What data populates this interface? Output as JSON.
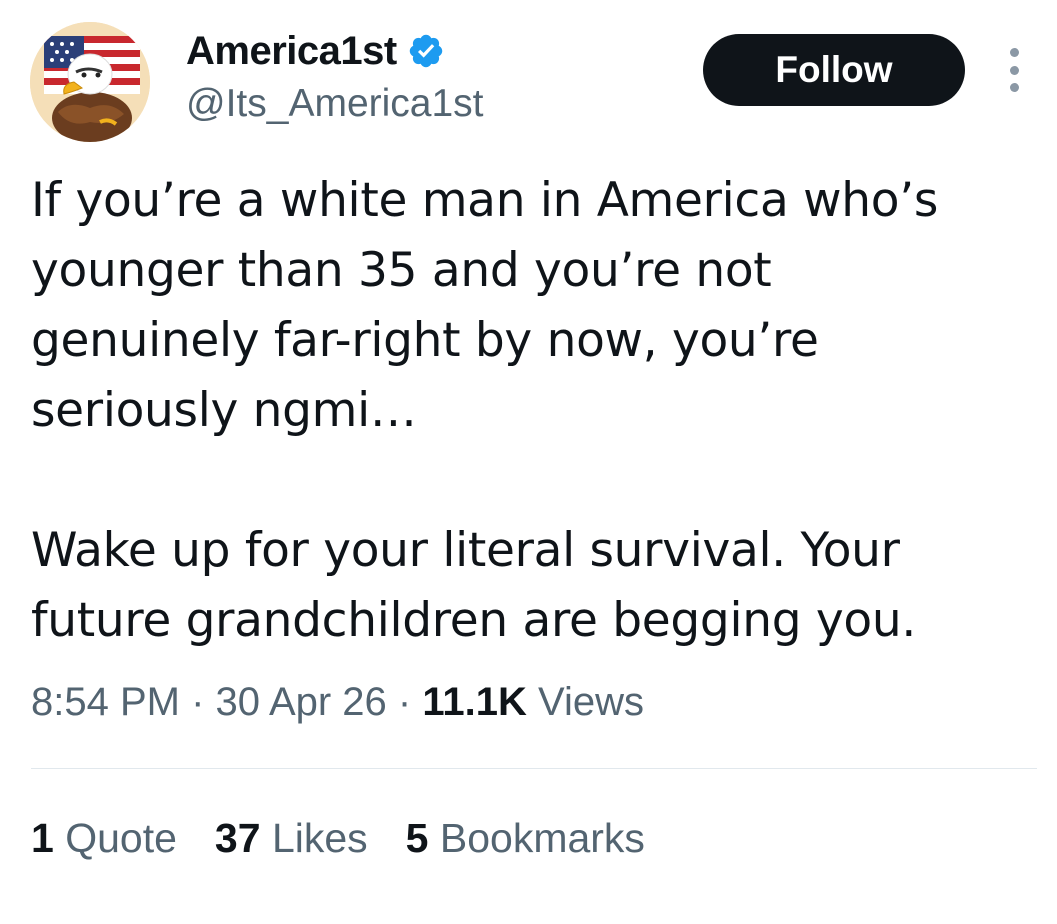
{
  "author": {
    "display_name": "America1st",
    "handle": "@Its_America1st",
    "verified": true
  },
  "follow_button": {
    "label": "Follow"
  },
  "tweet": {
    "paragraphs": [
      "If you’re a white man in America who’s younger than 35 and you’re not genuinely far-right by now, you’re seriously ngmi…",
      "Wake up for your literal survival. Your future grandchildren are begging you."
    ]
  },
  "meta": {
    "time": "8:54 PM",
    "separator": "·",
    "date": "30 Apr 26",
    "views_count": "11.1K",
    "views_label": "Views"
  },
  "stats": {
    "quotes": {
      "count": "1",
      "label": "Quote"
    },
    "likes": {
      "count": "37",
      "label": "Likes"
    },
    "bookmarks": {
      "count": "5",
      "label": "Bookmarks"
    }
  },
  "icons": {
    "avatar": "eagle-flag-avatar",
    "verified": "verified-badge-icon",
    "more": "more-vertical-icon"
  },
  "colors": {
    "text_primary": "#0f1419",
    "text_secondary": "#536471",
    "verified_blue": "#1d9bf0",
    "follow_bg": "#0f1419",
    "divider": "#e1e8ed"
  }
}
